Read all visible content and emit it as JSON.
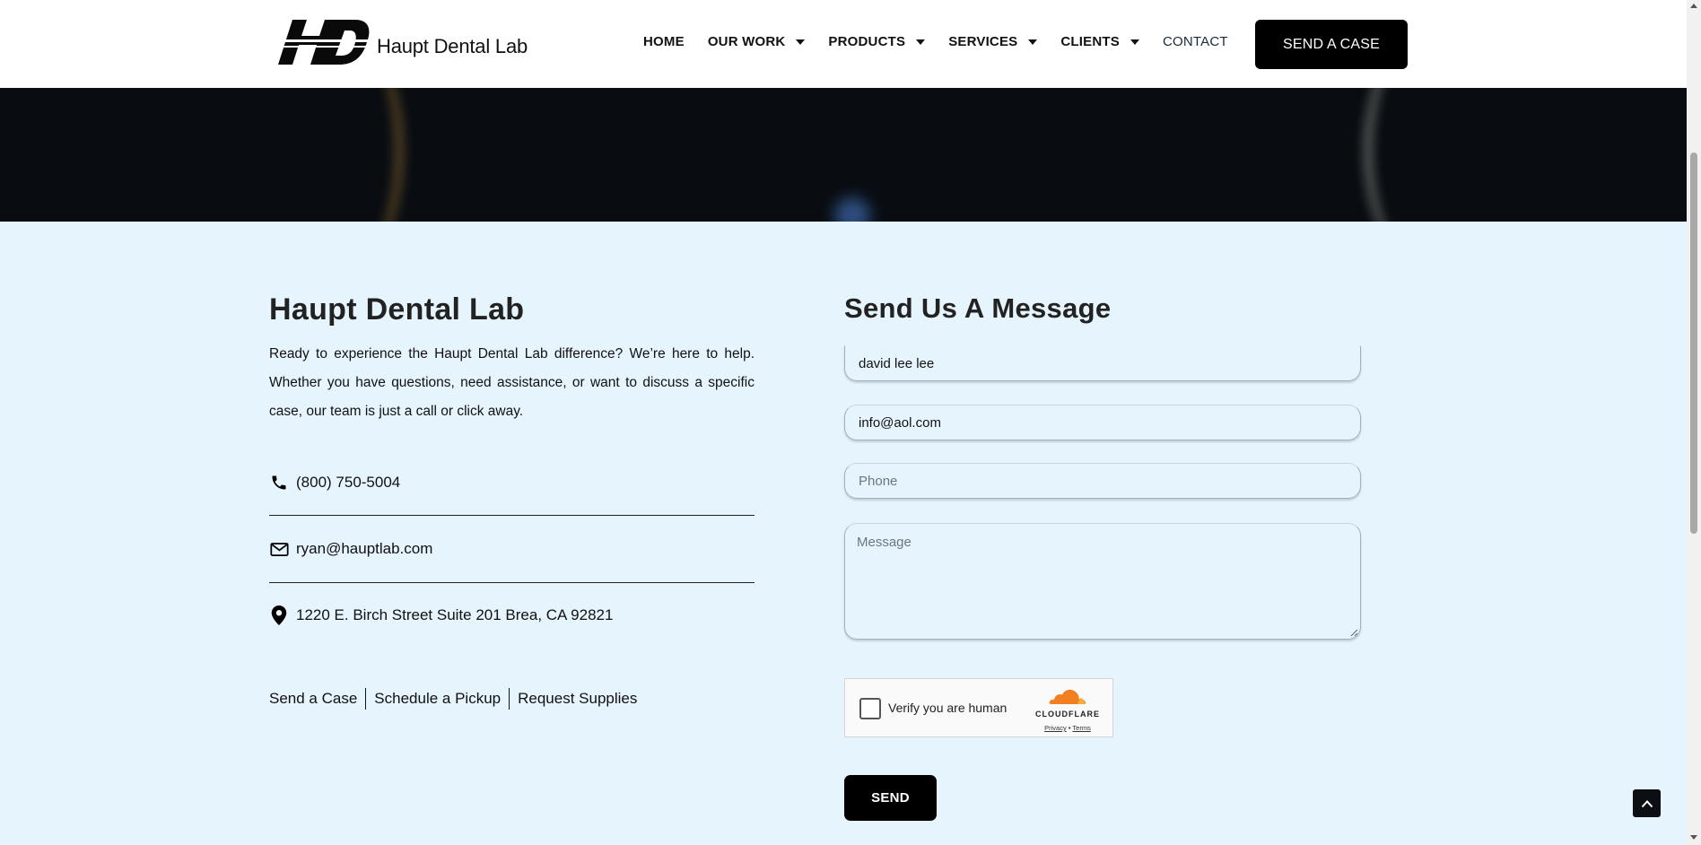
{
  "header": {
    "logo_text": "Haupt Dental Lab",
    "logo_mark": "HD",
    "nav": [
      {
        "label": "HOME",
        "dropdown": false
      },
      {
        "label": "OUR WORK",
        "dropdown": true
      },
      {
        "label": "PRODUCTS",
        "dropdown": true
      },
      {
        "label": "SERVICES",
        "dropdown": true
      },
      {
        "label": "CLIENTS",
        "dropdown": true
      },
      {
        "label": "CONTACT",
        "dropdown": false
      }
    ],
    "cta_label": "SEND A CASE"
  },
  "contact": {
    "title": "Haupt Dental Lab",
    "intro": "Ready to experience the Haupt Dental Lab difference? We’re here to help. Whether you have questions, need assistance, or want to discuss a specific case, our team is just a call or click away.",
    "phone": "(800) 750-5004",
    "email": "ryan@hauptlab.com",
    "address": "1220 E. Birch Street Suite 201 Brea, CA 92821",
    "links": [
      "Send a Case",
      "Schedule a Pickup",
      "Request Supplies"
    ]
  },
  "form": {
    "title": "Send Us A Message",
    "name_value": "david lee lee",
    "email_value": "info@aol.com",
    "phone_placeholder": "Phone",
    "message_placeholder": "Message",
    "captcha_label": "Verify you are human",
    "captcha_brand": "CLOUDFLARE",
    "captcha_privacy": "Privacy",
    "captcha_dot": "•",
    "captcha_terms": "Terms",
    "send_label": "SEND"
  },
  "colors": {
    "page_bg": "#e6f4fd",
    "button_bg": "#000000",
    "cloudflare_orange": "#f38020"
  }
}
